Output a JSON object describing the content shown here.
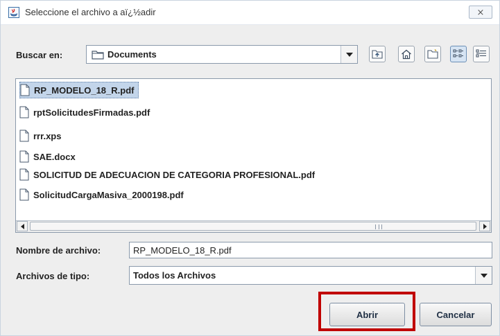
{
  "window": {
    "title": "Seleccione el archivo a aï¿½adir",
    "close_glyph": "⨯"
  },
  "lookin": {
    "label": "Buscar en:",
    "value": "Documents"
  },
  "toolbar": {
    "icons": [
      "up-one-level-icon",
      "home-icon",
      "new-folder-icon",
      "list-view-icon",
      "details-view-icon"
    ],
    "active_view": "list-view"
  },
  "files": [
    {
      "name": "RP_MODELO_18_R.pdf",
      "selected": true
    },
    {
      "name": "rptSolicitudesFirmadas.pdf",
      "selected": false
    },
    {
      "name": "rrr.xps",
      "selected": false
    },
    {
      "name": "SAE.docx",
      "selected": false
    },
    {
      "name": "SOLICITUD DE ADECUACION DE CATEGORIA PROFESIONAL.pdf",
      "selected": false
    },
    {
      "name": "SolicitudCargaMasiva_2000198.pdf",
      "selected": false
    }
  ],
  "filename": {
    "label": "Nombre de archivo:",
    "value": "RP_MODELO_18_R.pdf"
  },
  "filetype": {
    "label": "Archivos de tipo:",
    "value": "Todos los Archivos"
  },
  "buttons": {
    "open": "Abrir",
    "cancel": "Cancelar"
  },
  "colors": {
    "highlight": "#c00000",
    "selection": "#c3d5ea"
  }
}
